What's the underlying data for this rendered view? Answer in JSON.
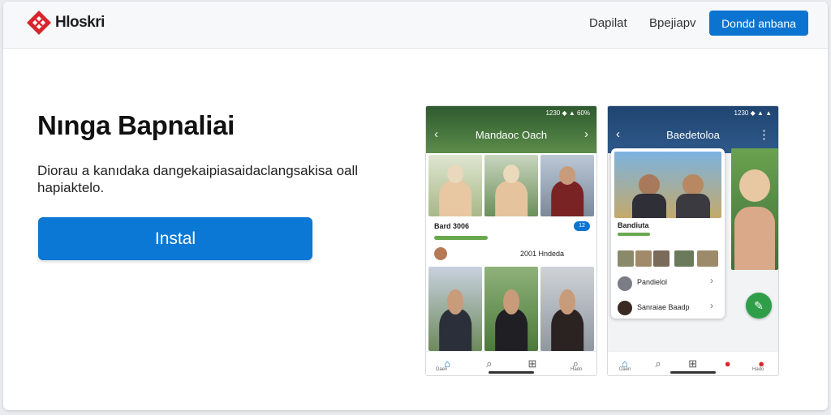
{
  "header": {
    "brand": "Hloskri",
    "nav": [
      "Dapilat",
      "Bpejiapv"
    ],
    "cta": "Dondd anbana"
  },
  "hero": {
    "title": "Nınga Bapnaliai",
    "description": "Diorau a kanıdaka dangekaipiasaidaclangsakisa oall hapiaktelo.",
    "install": "Instal"
  },
  "phone_a": {
    "status": "1230 ◆ ▲ 60%",
    "title": "Mandaoc Oach",
    "card_title": "Bard 3006",
    "card_sub": "2001 Hndeda",
    "badge": "12"
  },
  "phone_b": {
    "status": "1230 ◆ ▲ ▲",
    "title": "Baedetoloa",
    "card_title": "Bandiuta",
    "items": [
      "Pandielol",
      "Sanraiae Baadp"
    ]
  },
  "nav_labels": [
    "Daen",
    "Hado"
  ],
  "colors": {
    "accent": "#0b74d1",
    "brand_red": "#d7262e",
    "header_bg": "#f7f8f9"
  }
}
